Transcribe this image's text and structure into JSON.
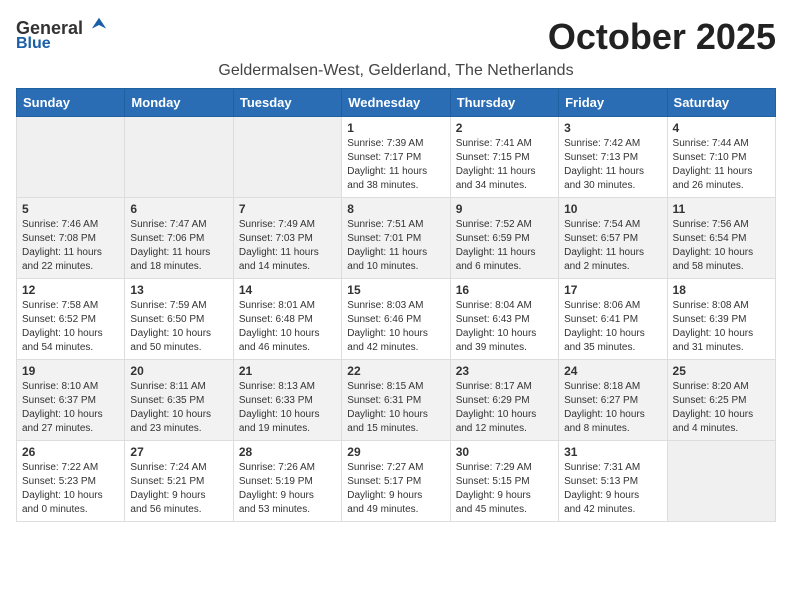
{
  "logo": {
    "general": "General",
    "blue": "Blue"
  },
  "title": "October 2025",
  "subtitle": "Geldermalsen-West, Gelderland, The Netherlands",
  "headers": [
    "Sunday",
    "Monday",
    "Tuesday",
    "Wednesday",
    "Thursday",
    "Friday",
    "Saturday"
  ],
  "rows": [
    [
      {
        "day": "",
        "info": ""
      },
      {
        "day": "",
        "info": ""
      },
      {
        "day": "",
        "info": ""
      },
      {
        "day": "1",
        "info": "Sunrise: 7:39 AM\nSunset: 7:17 PM\nDaylight: 11 hours\nand 38 minutes."
      },
      {
        "day": "2",
        "info": "Sunrise: 7:41 AM\nSunset: 7:15 PM\nDaylight: 11 hours\nand 34 minutes."
      },
      {
        "day": "3",
        "info": "Sunrise: 7:42 AM\nSunset: 7:13 PM\nDaylight: 11 hours\nand 30 minutes."
      },
      {
        "day": "4",
        "info": "Sunrise: 7:44 AM\nSunset: 7:10 PM\nDaylight: 11 hours\nand 26 minutes."
      }
    ],
    [
      {
        "day": "5",
        "info": "Sunrise: 7:46 AM\nSunset: 7:08 PM\nDaylight: 11 hours\nand 22 minutes."
      },
      {
        "day": "6",
        "info": "Sunrise: 7:47 AM\nSunset: 7:06 PM\nDaylight: 11 hours\nand 18 minutes."
      },
      {
        "day": "7",
        "info": "Sunrise: 7:49 AM\nSunset: 7:03 PM\nDaylight: 11 hours\nand 14 minutes."
      },
      {
        "day": "8",
        "info": "Sunrise: 7:51 AM\nSunset: 7:01 PM\nDaylight: 11 hours\nand 10 minutes."
      },
      {
        "day": "9",
        "info": "Sunrise: 7:52 AM\nSunset: 6:59 PM\nDaylight: 11 hours\nand 6 minutes."
      },
      {
        "day": "10",
        "info": "Sunrise: 7:54 AM\nSunset: 6:57 PM\nDaylight: 11 hours\nand 2 minutes."
      },
      {
        "day": "11",
        "info": "Sunrise: 7:56 AM\nSunset: 6:54 PM\nDaylight: 10 hours\nand 58 minutes."
      }
    ],
    [
      {
        "day": "12",
        "info": "Sunrise: 7:58 AM\nSunset: 6:52 PM\nDaylight: 10 hours\nand 54 minutes."
      },
      {
        "day": "13",
        "info": "Sunrise: 7:59 AM\nSunset: 6:50 PM\nDaylight: 10 hours\nand 50 minutes."
      },
      {
        "day": "14",
        "info": "Sunrise: 8:01 AM\nSunset: 6:48 PM\nDaylight: 10 hours\nand 46 minutes."
      },
      {
        "day": "15",
        "info": "Sunrise: 8:03 AM\nSunset: 6:46 PM\nDaylight: 10 hours\nand 42 minutes."
      },
      {
        "day": "16",
        "info": "Sunrise: 8:04 AM\nSunset: 6:43 PM\nDaylight: 10 hours\nand 39 minutes."
      },
      {
        "day": "17",
        "info": "Sunrise: 8:06 AM\nSunset: 6:41 PM\nDaylight: 10 hours\nand 35 minutes."
      },
      {
        "day": "18",
        "info": "Sunrise: 8:08 AM\nSunset: 6:39 PM\nDaylight: 10 hours\nand 31 minutes."
      }
    ],
    [
      {
        "day": "19",
        "info": "Sunrise: 8:10 AM\nSunset: 6:37 PM\nDaylight: 10 hours\nand 27 minutes."
      },
      {
        "day": "20",
        "info": "Sunrise: 8:11 AM\nSunset: 6:35 PM\nDaylight: 10 hours\nand 23 minutes."
      },
      {
        "day": "21",
        "info": "Sunrise: 8:13 AM\nSunset: 6:33 PM\nDaylight: 10 hours\nand 19 minutes."
      },
      {
        "day": "22",
        "info": "Sunrise: 8:15 AM\nSunset: 6:31 PM\nDaylight: 10 hours\nand 15 minutes."
      },
      {
        "day": "23",
        "info": "Sunrise: 8:17 AM\nSunset: 6:29 PM\nDaylight: 10 hours\nand 12 minutes."
      },
      {
        "day": "24",
        "info": "Sunrise: 8:18 AM\nSunset: 6:27 PM\nDaylight: 10 hours\nand 8 minutes."
      },
      {
        "day": "25",
        "info": "Sunrise: 8:20 AM\nSunset: 6:25 PM\nDaylight: 10 hours\nand 4 minutes."
      }
    ],
    [
      {
        "day": "26",
        "info": "Sunrise: 7:22 AM\nSunset: 5:23 PM\nDaylight: 10 hours\nand 0 minutes."
      },
      {
        "day": "27",
        "info": "Sunrise: 7:24 AM\nSunset: 5:21 PM\nDaylight: 9 hours\nand 56 minutes."
      },
      {
        "day": "28",
        "info": "Sunrise: 7:26 AM\nSunset: 5:19 PM\nDaylight: 9 hours\nand 53 minutes."
      },
      {
        "day": "29",
        "info": "Sunrise: 7:27 AM\nSunset: 5:17 PM\nDaylight: 9 hours\nand 49 minutes."
      },
      {
        "day": "30",
        "info": "Sunrise: 7:29 AM\nSunset: 5:15 PM\nDaylight: 9 hours\nand 45 minutes."
      },
      {
        "day": "31",
        "info": "Sunrise: 7:31 AM\nSunset: 5:13 PM\nDaylight: 9 hours\nand 42 minutes."
      },
      {
        "day": "",
        "info": ""
      }
    ]
  ]
}
